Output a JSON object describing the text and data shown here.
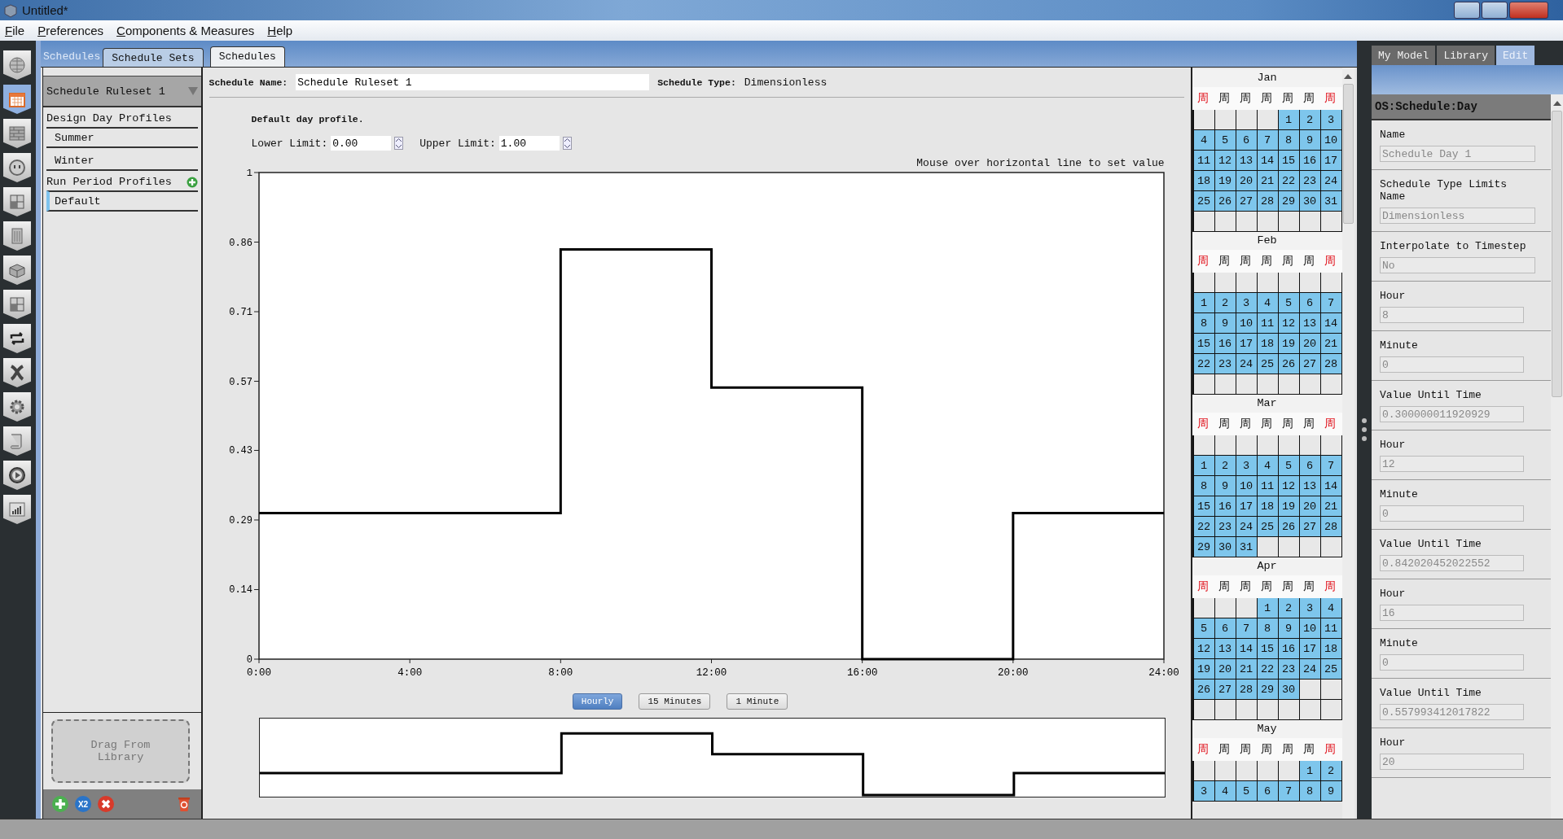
{
  "window": {
    "title": "Untitled*"
  },
  "menu": [
    {
      "label": "File"
    },
    {
      "label": "Preferences"
    },
    {
      "label": "Components & Measures"
    },
    {
      "label": "Help"
    }
  ],
  "nav_items": [
    {
      "kind": "globe",
      "selected": false
    },
    {
      "kind": "calendar",
      "selected": true
    },
    {
      "kind": "bricks",
      "selected": false
    },
    {
      "kind": "outlet",
      "selected": false
    },
    {
      "kind": "cubes",
      "selected": false
    },
    {
      "kind": "building",
      "selected": false
    },
    {
      "kind": "box",
      "selected": false
    },
    {
      "kind": "cubes",
      "selected": false
    },
    {
      "kind": "loop",
      "selected": false
    },
    {
      "kind": "cross",
      "selected": false
    },
    {
      "kind": "gear",
      "selected": false
    },
    {
      "kind": "scroll",
      "selected": false
    },
    {
      "kind": "play",
      "selected": false
    },
    {
      "kind": "chart",
      "selected": false
    }
  ],
  "section_label": "Schedules",
  "tabs": [
    {
      "label": "Schedule Sets",
      "selected": false
    },
    {
      "label": "Schedules",
      "selected": true
    }
  ],
  "sidebar": {
    "dropdown": "Schedule Ruleset 1",
    "groups": [
      {
        "title": "Design Day Profiles",
        "add_button": false,
        "items": [
          {
            "label": "Summer",
            "selected": false
          },
          {
            "label": "Winter",
            "selected": false
          }
        ]
      },
      {
        "title": "Run Period Profiles",
        "add_button": true,
        "items": [
          {
            "label": "Default",
            "selected": true
          }
        ]
      }
    ],
    "drop_zone": "Drag From Library",
    "duplicate_label": "X2"
  },
  "schedule": {
    "name_label": "Schedule Name:",
    "name": "Schedule Ruleset 1",
    "type_label": "Schedule Type:",
    "type": "Dimensionless",
    "profile_title": "Default day profile.",
    "lower_label": "Lower Limit:",
    "lower": "0.00",
    "upper_label": "Upper Limit:",
    "upper": "1.00",
    "hint": "Mouse over horizontal line to set value",
    "chart_data": {
      "type": "line",
      "x": [
        0,
        8,
        8,
        12,
        12,
        16,
        16,
        20,
        20,
        24
      ],
      "series": [
        {
          "color": "#000000",
          "values": [
            0.3,
            0.3,
            0.842,
            0.842,
            0.558,
            0.558,
            0,
            0,
            0.3,
            0.3
          ]
        }
      ],
      "xlim": [
        0,
        24
      ],
      "ylim": [
        0,
        1
      ],
      "xticks": [
        {
          "value": 0,
          "label": "0:00"
        },
        {
          "value": 4,
          "label": "4:00"
        },
        {
          "value": 8,
          "label": "8:00"
        },
        {
          "value": 12,
          "label": "12:00"
        },
        {
          "value": 16,
          "label": "16:00"
        },
        {
          "value": 20,
          "label": "20:00"
        },
        {
          "value": 24,
          "label": "24:00"
        }
      ],
      "yticks": [
        0,
        {
          "value": 0.143,
          "label": "0.14"
        },
        {
          "value": 0.286,
          "label": "0.29"
        },
        {
          "value": 0.429,
          "label": "0.43"
        },
        {
          "value": 0.571,
          "label": "0.57"
        },
        {
          "value": 0.714,
          "label": "0.71"
        },
        {
          "value": 0.857,
          "label": "0.86"
        },
        1
      ]
    },
    "resolutions": [
      {
        "label": "Hourly",
        "selected": true
      },
      {
        "label": "15 Minutes",
        "selected": false
      },
      {
        "label": "1 Minute",
        "selected": false
      }
    ]
  },
  "calendar": [
    {
      "month": "Jan",
      "weekdays": [
        {
          "text": "周",
          "weekend": true
        },
        {
          "text": "周",
          "weekend": false
        },
        {
          "text": "周",
          "weekend": false
        },
        {
          "text": "周",
          "weekend": false
        },
        {
          "text": "周",
          "weekend": false
        },
        {
          "text": "周",
          "weekend": false
        },
        {
          "text": "周",
          "weekend": true
        }
      ],
      "weeks": [
        [
          {
            "kind": "blank"
          },
          {
            "kind": "blank"
          },
          {
            "kind": "blank"
          },
          {
            "kind": "blank"
          },
          {
            "kind": "day",
            "day": "1"
          },
          {
            "kind": "day",
            "day": "2"
          },
          {
            "kind": "day",
            "day": "3"
          }
        ],
        [
          {
            "kind": "day",
            "day": "4"
          },
          {
            "kind": "day",
            "day": "5"
          },
          {
            "kind": "day",
            "day": "6"
          },
          {
            "kind": "day",
            "day": "7"
          },
          {
            "kind": "day",
            "day": "8"
          },
          {
            "kind": "day",
            "day": "9"
          },
          {
            "kind": "day",
            "day": "10"
          }
        ],
        [
          {
            "kind": "day",
            "day": "11"
          },
          {
            "kind": "day",
            "day": "12"
          },
          {
            "kind": "day",
            "day": "13"
          },
          {
            "kind": "day",
            "day": "14"
          },
          {
            "kind": "day",
            "day": "15"
          },
          {
            "kind": "day",
            "day": "16"
          },
          {
            "kind": "day",
            "day": "17"
          }
        ],
        [
          {
            "kind": "day",
            "day": "18"
          },
          {
            "kind": "day",
            "day": "19"
          },
          {
            "kind": "day",
            "day": "20"
          },
          {
            "kind": "day",
            "day": "21"
          },
          {
            "kind": "day",
            "day": "22"
          },
          {
            "kind": "day",
            "day": "23"
          },
          {
            "kind": "day",
            "day": "24"
          }
        ],
        [
          {
            "kind": "day",
            "day": "25"
          },
          {
            "kind": "day",
            "day": "26"
          },
          {
            "kind": "day",
            "day": "27"
          },
          {
            "kind": "day",
            "day": "28"
          },
          {
            "kind": "day",
            "day": "29"
          },
          {
            "kind": "day",
            "day": "30"
          },
          {
            "kind": "day",
            "day": "31"
          }
        ],
        [
          {
            "kind": "blank"
          },
          {
            "kind": "blank"
          },
          {
            "kind": "blank"
          },
          {
            "kind": "blank"
          },
          {
            "kind": "blank"
          },
          {
            "kind": "blank"
          },
          {
            "kind": "blank"
          }
        ]
      ]
    },
    {
      "month": "Feb",
      "weekdays": [
        {
          "text": "周",
          "weekend": true
        },
        {
          "text": "周",
          "weekend": false
        },
        {
          "text": "周",
          "weekend": false
        },
        {
          "text": "周",
          "weekend": false
        },
        {
          "text": "周",
          "weekend": false
        },
        {
          "text": "周",
          "weekend": false
        },
        {
          "text": "周",
          "weekend": true
        }
      ],
      "weeks": [
        [
          {
            "kind": "blank"
          },
          {
            "kind": "blank"
          },
          {
            "kind": "blank"
          },
          {
            "kind": "blank"
          },
          {
            "kind": "blank"
          },
          {
            "kind": "blank"
          },
          {
            "kind": "blank"
          }
        ],
        [
          {
            "kind": "day",
            "day": "1"
          },
          {
            "kind": "day",
            "day": "2"
          },
          {
            "kind": "day",
            "day": "3"
          },
          {
            "kind": "day",
            "day": "4"
          },
          {
            "kind": "day",
            "day": "5"
          },
          {
            "kind": "day",
            "day": "6"
          },
          {
            "kind": "day",
            "day": "7"
          }
        ],
        [
          {
            "kind": "day",
            "day": "8"
          },
          {
            "kind": "day",
            "day": "9"
          },
          {
            "kind": "day",
            "day": "10"
          },
          {
            "kind": "day",
            "day": "11"
          },
          {
            "kind": "day",
            "day": "12"
          },
          {
            "kind": "day",
            "day": "13"
          },
          {
            "kind": "day",
            "day": "14"
          }
        ],
        [
          {
            "kind": "day",
            "day": "15"
          },
          {
            "kind": "day",
            "day": "16"
          },
          {
            "kind": "day",
            "day": "17"
          },
          {
            "kind": "day",
            "day": "18"
          },
          {
            "kind": "day",
            "day": "19"
          },
          {
            "kind": "day",
            "day": "20"
          },
          {
            "kind": "day",
            "day": "21"
          }
        ],
        [
          {
            "kind": "day",
            "day": "22"
          },
          {
            "kind": "day",
            "day": "23"
          },
          {
            "kind": "day",
            "day": "24"
          },
          {
            "kind": "day",
            "day": "25"
          },
          {
            "kind": "day",
            "day": "26"
          },
          {
            "kind": "day",
            "day": "27"
          },
          {
            "kind": "day",
            "day": "28"
          }
        ],
        [
          {
            "kind": "blank"
          },
          {
            "kind": "blank"
          },
          {
            "kind": "blank"
          },
          {
            "kind": "blank"
          },
          {
            "kind": "blank"
          },
          {
            "kind": "blank"
          },
          {
            "kind": "blank"
          }
        ]
      ]
    },
    {
      "month": "Mar",
      "weekdays": [
        {
          "text": "周",
          "weekend": true
        },
        {
          "text": "周",
          "weekend": false
        },
        {
          "text": "周",
          "weekend": false
        },
        {
          "text": "周",
          "weekend": false
        },
        {
          "text": "周",
          "weekend": false
        },
        {
          "text": "周",
          "weekend": false
        },
        {
          "text": "周",
          "weekend": true
        }
      ],
      "weeks": [
        [
          {
            "kind": "blank"
          },
          {
            "kind": "blank"
          },
          {
            "kind": "blank"
          },
          {
            "kind": "blank"
          },
          {
            "kind": "blank"
          },
          {
            "kind": "blank"
          },
          {
            "kind": "blank"
          }
        ],
        [
          {
            "kind": "day",
            "day": "1"
          },
          {
            "kind": "day",
            "day": "2"
          },
          {
            "kind": "day",
            "day": "3"
          },
          {
            "kind": "day",
            "day": "4"
          },
          {
            "kind": "day",
            "day": "5"
          },
          {
            "kind": "day",
            "day": "6"
          },
          {
            "kind": "day",
            "day": "7"
          }
        ],
        [
          {
            "kind": "day",
            "day": "8"
          },
          {
            "kind": "day",
            "day": "9"
          },
          {
            "kind": "day",
            "day": "10"
          },
          {
            "kind": "day",
            "day": "11"
          },
          {
            "kind": "day",
            "day": "12"
          },
          {
            "kind": "day",
            "day": "13"
          },
          {
            "kind": "day",
            "day": "14"
          }
        ],
        [
          {
            "kind": "day",
            "day": "15"
          },
          {
            "kind": "day",
            "day": "16"
          },
          {
            "kind": "day",
            "day": "17"
          },
          {
            "kind": "day",
            "day": "18"
          },
          {
            "kind": "day",
            "day": "19"
          },
          {
            "kind": "day",
            "day": "20"
          },
          {
            "kind": "day",
            "day": "21"
          }
        ],
        [
          {
            "kind": "day",
            "day": "22"
          },
          {
            "kind": "day",
            "day": "23"
          },
          {
            "kind": "day",
            "day": "24"
          },
          {
            "kind": "day",
            "day": "25"
          },
          {
            "kind": "day",
            "day": "26"
          },
          {
            "kind": "day",
            "day": "27"
          },
          {
            "kind": "day",
            "day": "28"
          }
        ],
        [
          {
            "kind": "day",
            "day": "29"
          },
          {
            "kind": "day",
            "day": "30"
          },
          {
            "kind": "day",
            "day": "31"
          },
          {
            "kind": "blank"
          },
          {
            "kind": "blank"
          },
          {
            "kind": "blank"
          },
          {
            "kind": "blank"
          }
        ]
      ]
    },
    {
      "month": "Apr",
      "weekdays": [
        {
          "text": "周",
          "weekend": true
        },
        {
          "text": "周",
          "weekend": false
        },
        {
          "text": "周",
          "weekend": false
        },
        {
          "text": "周",
          "weekend": false
        },
        {
          "text": "周",
          "weekend": false
        },
        {
          "text": "周",
          "weekend": false
        },
        {
          "text": "周",
          "weekend": true
        }
      ],
      "weeks": [
        [
          {
            "kind": "blank"
          },
          {
            "kind": "blank"
          },
          {
            "kind": "blank"
          },
          {
            "kind": "day",
            "day": "1"
          },
          {
            "kind": "day",
            "day": "2"
          },
          {
            "kind": "day",
            "day": "3"
          },
          {
            "kind": "day",
            "day": "4"
          }
        ],
        [
          {
            "kind": "day",
            "day": "5"
          },
          {
            "kind": "day",
            "day": "6"
          },
          {
            "kind": "day",
            "day": "7"
          },
          {
            "kind": "day",
            "day": "8"
          },
          {
            "kind": "day",
            "day": "9"
          },
          {
            "kind": "day",
            "day": "10"
          },
          {
            "kind": "day",
            "day": "11"
          }
        ],
        [
          {
            "kind": "day",
            "day": "12"
          },
          {
            "kind": "day",
            "day": "13"
          },
          {
            "kind": "day",
            "day": "14"
          },
          {
            "kind": "day",
            "day": "15"
          },
          {
            "kind": "day",
            "day": "16"
          },
          {
            "kind": "day",
            "day": "17"
          },
          {
            "kind": "day",
            "day": "18"
          }
        ],
        [
          {
            "kind": "day",
            "day": "19"
          },
          {
            "kind": "day",
            "day": "20"
          },
          {
            "kind": "day",
            "day": "21"
          },
          {
            "kind": "day",
            "day": "22"
          },
          {
            "kind": "day",
            "day": "23"
          },
          {
            "kind": "day",
            "day": "24"
          },
          {
            "kind": "day",
            "day": "25"
          }
        ],
        [
          {
            "kind": "day",
            "day": "26"
          },
          {
            "kind": "day",
            "day": "27"
          },
          {
            "kind": "day",
            "day": "28"
          },
          {
            "kind": "day",
            "day": "29"
          },
          {
            "kind": "day",
            "day": "30"
          },
          {
            "kind": "blank"
          },
          {
            "kind": "blank"
          }
        ],
        [
          {
            "kind": "blank"
          },
          {
            "kind": "blank"
          },
          {
            "kind": "blank"
          },
          {
            "kind": "blank"
          },
          {
            "kind": "blank"
          },
          {
            "kind": "blank"
          },
          {
            "kind": "blank"
          }
        ]
      ]
    },
    {
      "month": "May",
      "weekdays": [
        {
          "text": "周",
          "weekend": true
        },
        {
          "text": "周",
          "weekend": false
        },
        {
          "text": "周",
          "weekend": false
        },
        {
          "text": "周",
          "weekend": false
        },
        {
          "text": "周",
          "weekend": false
        },
        {
          "text": "周",
          "weekend": false
        },
        {
          "text": "周",
          "weekend": true
        }
      ],
      "weeks": [
        [
          {
            "kind": "blank"
          },
          {
            "kind": "blank"
          },
          {
            "kind": "blank"
          },
          {
            "kind": "blank"
          },
          {
            "kind": "blank"
          },
          {
            "kind": "day",
            "day": "1"
          },
          {
            "kind": "day",
            "day": "2"
          }
        ],
        [
          {
            "kind": "day",
            "day": "3"
          },
          {
            "kind": "day",
            "day": "4"
          },
          {
            "kind": "day",
            "day": "5"
          },
          {
            "kind": "day",
            "day": "6"
          },
          {
            "kind": "day",
            "day": "7"
          },
          {
            "kind": "day",
            "day": "8"
          },
          {
            "kind": "day",
            "day": "9"
          }
        ]
      ]
    }
  ],
  "inspector": {
    "tabs": [
      {
        "label": "My Model",
        "selected": false
      },
      {
        "label": "Library",
        "selected": false
      },
      {
        "label": "Edit",
        "selected": true
      }
    ],
    "title": "OS:Schedule:Day",
    "fields": [
      {
        "label": "Name",
        "value": "Schedule Day 1",
        "kind": "text"
      },
      {
        "label": "Schedule Type Limits Name",
        "value": "Dimensionless",
        "kind": "text"
      },
      {
        "label": "Interpolate to Timestep",
        "value": "No",
        "kind": "text"
      },
      {
        "label": "Hour",
        "value": "8",
        "kind": "number"
      },
      {
        "label": "Minute",
        "value": "0",
        "kind": "number"
      },
      {
        "label": "Value Until Time",
        "value": "0.300000011920929",
        "kind": "number"
      },
      {
        "label": "Hour",
        "value": "12",
        "kind": "number"
      },
      {
        "label": "Minute",
        "value": "0",
        "kind": "number"
      },
      {
        "label": "Value Until Time",
        "value": "0.842020452022552",
        "kind": "number"
      },
      {
        "label": "Hour",
        "value": "16",
        "kind": "number"
      },
      {
        "label": "Minute",
        "value": "0",
        "kind": "number"
      },
      {
        "label": "Value Until Time",
        "value": "0.557993412017822",
        "kind": "number"
      },
      {
        "label": "Hour",
        "value": "20",
        "kind": "number"
      }
    ]
  }
}
